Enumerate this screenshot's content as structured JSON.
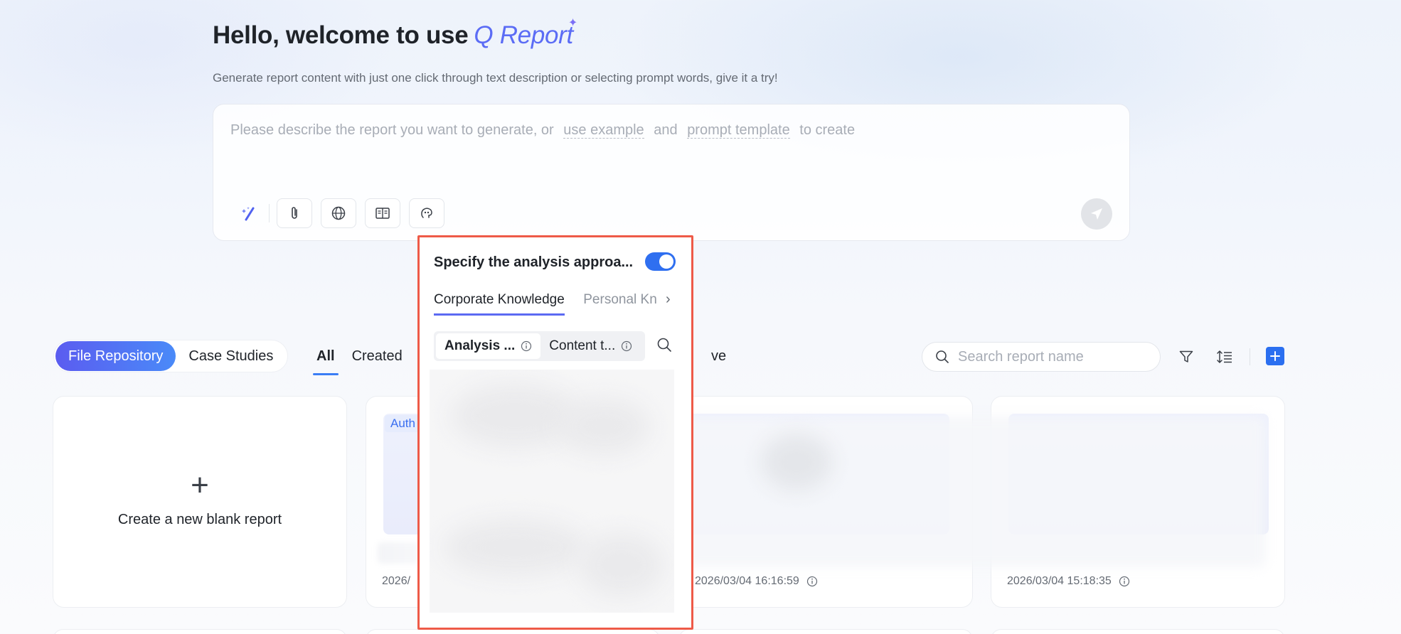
{
  "hero": {
    "greeting": "Hello, welcome to use",
    "brand": "Q Report",
    "subtitle": "Generate report content with just one click through text description or selecting prompt words, give it a try!"
  },
  "prompt": {
    "placeholder_start": "Please describe the report you want to generate, or",
    "link_example": "use example",
    "joiner": "and",
    "link_template": "prompt template",
    "placeholder_end": "to create",
    "tools": [
      "magic-wand-icon",
      "paperclip-icon",
      "globe-icon",
      "book-icon",
      "thinking-icon"
    ],
    "send_icon": "send-icon"
  },
  "repo_toggle": {
    "items": [
      "File Repository",
      "Case Studies"
    ],
    "active": "File Repository"
  },
  "filter_tabs": {
    "items": [
      "All",
      "Created"
    ],
    "active": "All",
    "tail": "ve"
  },
  "search": {
    "placeholder": "Search report name"
  },
  "actions": [
    "filter-icon",
    "sort-icon",
    "add-icon"
  ],
  "cards": {
    "new_label": "Create a new blank report",
    "card2_tag": "Auth",
    "card2_ts_partial": "2026/",
    "card2_ts": "2026/03/04 16:16:59",
    "card3_ts": "2026/03/04 15:18:35"
  },
  "popover": {
    "title": "Specify the analysis approa...",
    "toggle_on": true,
    "tabs": [
      "Corporate Knowledge",
      "Personal Kn"
    ],
    "active_tab": "Corporate Knowledge",
    "pills": [
      "Analysis ...",
      "Content t..."
    ],
    "active_pill": "Analysis ..."
  },
  "colors": {
    "accent": "#5b6cf5",
    "primary_blue": "#2f6ff0",
    "highlight_border": "#ee5a48"
  }
}
